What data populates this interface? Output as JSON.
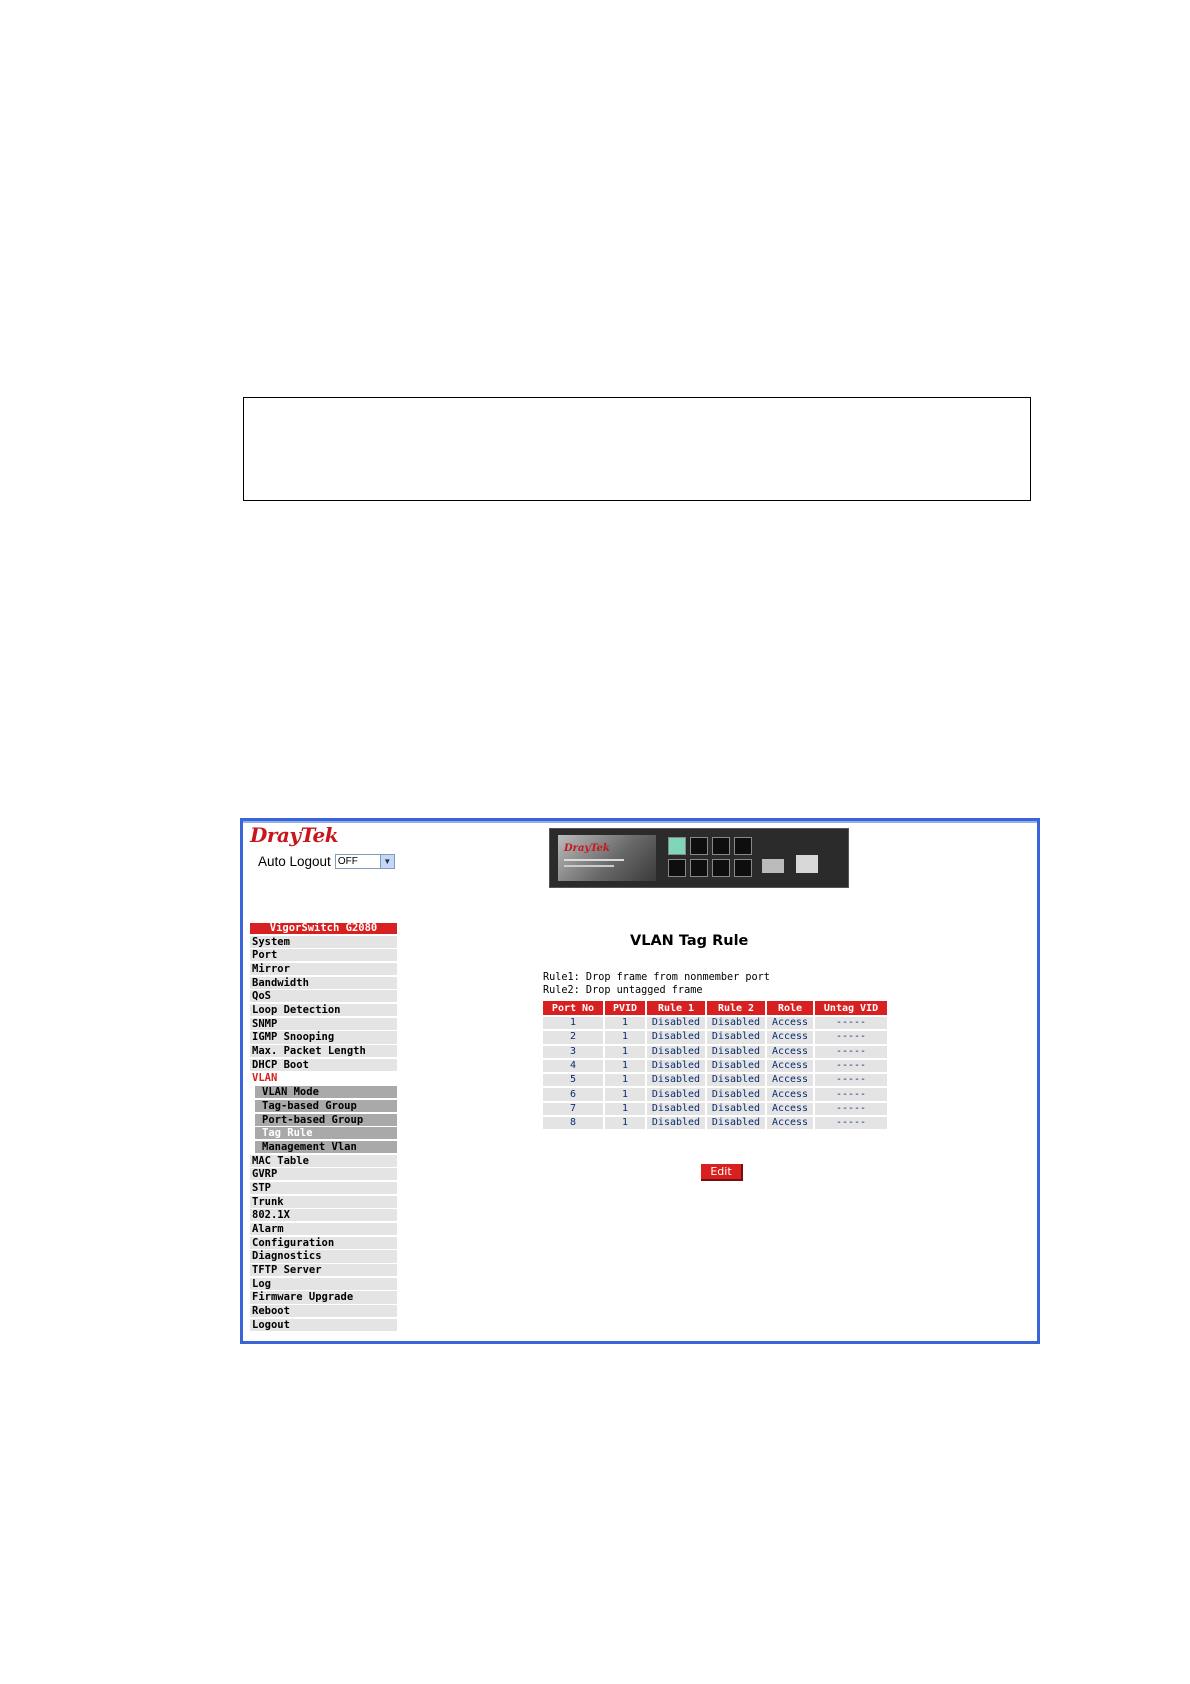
{
  "logo": {
    "dray": "Dray",
    "tek": "Tek"
  },
  "auto_logout": {
    "label": "Auto Logout",
    "value": "OFF"
  },
  "device": {
    "brand": "DrayTek"
  },
  "sidebar": {
    "title": "VigorSwitch G2080",
    "items_top": [
      "System",
      "Port",
      "Mirror",
      "Bandwidth",
      "QoS",
      "Loop Detection",
      "SNMP",
      "IGMP Snooping",
      "Max. Packet Length",
      "DHCP Boot"
    ],
    "vlan_label": "VLAN",
    "vlan_subitems": [
      "VLAN Mode",
      "Tag-based Group",
      "Port-based Group",
      "Tag Rule",
      "Management Vlan"
    ],
    "items_bottom": [
      "MAC Table",
      "GVRP",
      "STP",
      "Trunk",
      "802.1X",
      "Alarm",
      "Configuration",
      "Diagnostics",
      "TFTP Server",
      "Log",
      "Firmware Upgrade",
      "Reboot",
      "Logout"
    ]
  },
  "main": {
    "title": "VLAN Tag Rule",
    "rule1": "Rule1: Drop frame from nonmember port",
    "rule2": "Rule2: Drop untagged frame",
    "columns": [
      "Port No",
      "PVID",
      "Rule 1",
      "Rule 2",
      "Role",
      "Untag VID"
    ],
    "rows": [
      [
        "1",
        "1",
        "Disabled",
        "Disabled",
        "Access",
        "-----"
      ],
      [
        "2",
        "1",
        "Disabled",
        "Disabled",
        "Access",
        "-----"
      ],
      [
        "3",
        "1",
        "Disabled",
        "Disabled",
        "Access",
        "-----"
      ],
      [
        "4",
        "1",
        "Disabled",
        "Disabled",
        "Access",
        "-----"
      ],
      [
        "5",
        "1",
        "Disabled",
        "Disabled",
        "Access",
        "-----"
      ],
      [
        "6",
        "1",
        "Disabled",
        "Disabled",
        "Access",
        "-----"
      ],
      [
        "7",
        "1",
        "Disabled",
        "Disabled",
        "Access",
        "-----"
      ],
      [
        "8",
        "1",
        "Disabled",
        "Disabled",
        "Access",
        "-----"
      ]
    ],
    "edit_label": "Edit"
  },
  "colors": {
    "accent_red": "#d7201f",
    "frame_blue": "#3a64d8",
    "menu_gray": "#e4e4e4",
    "submenu_gray": "#a9a9a9"
  }
}
